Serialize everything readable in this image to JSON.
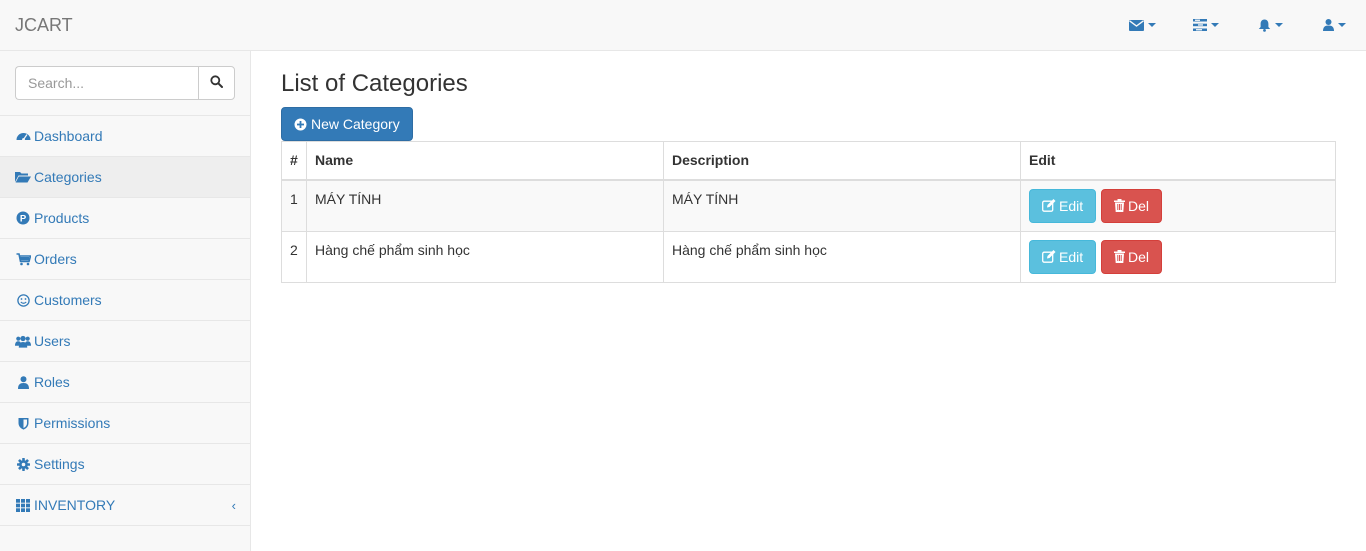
{
  "app": {
    "brand": "JCART"
  },
  "navbar": {
    "items": [
      {
        "icon": "envelope-icon"
      },
      {
        "icon": "tasks-icon"
      },
      {
        "icon": "bell-icon"
      },
      {
        "icon": "user-icon"
      }
    ]
  },
  "sidebar": {
    "search": {
      "placeholder": "Search...",
      "value": ""
    },
    "items": [
      {
        "label": "Dashboard",
        "icon": "dashboard-icon"
      },
      {
        "label": "Categories",
        "icon": "folder-open-icon",
        "active": true
      },
      {
        "label": "Products",
        "icon": "product-icon"
      },
      {
        "label": "Orders",
        "icon": "cart-icon"
      },
      {
        "label": "Customers",
        "icon": "smile-icon"
      },
      {
        "label": "Users",
        "icon": "users-icon"
      },
      {
        "label": "Roles",
        "icon": "user-icon"
      },
      {
        "label": "Permissions",
        "icon": "shield-icon"
      },
      {
        "label": "Settings",
        "icon": "gear-icon"
      },
      {
        "label": "INVENTORY",
        "icon": "grid-icon",
        "chevron": "‹"
      }
    ]
  },
  "main": {
    "title": "List of Categories",
    "new_button": "New Category",
    "table": {
      "headers": [
        "#",
        "Name",
        "Description",
        "Edit"
      ],
      "rows": [
        {
          "num": "1",
          "name": "MÁY TÍNH",
          "description": "MÁY TÍNH"
        },
        {
          "num": "2",
          "name": "Hàng chế phẩm sinh học",
          "description": "Hàng chế phẩm sinh học"
        }
      ],
      "edit_label": "Edit",
      "del_label": "Del"
    }
  },
  "colors": {
    "primary": "#337ab7",
    "info": "#5bc0de",
    "danger": "#d9534f",
    "navbar_bg": "#f8f8f8"
  }
}
